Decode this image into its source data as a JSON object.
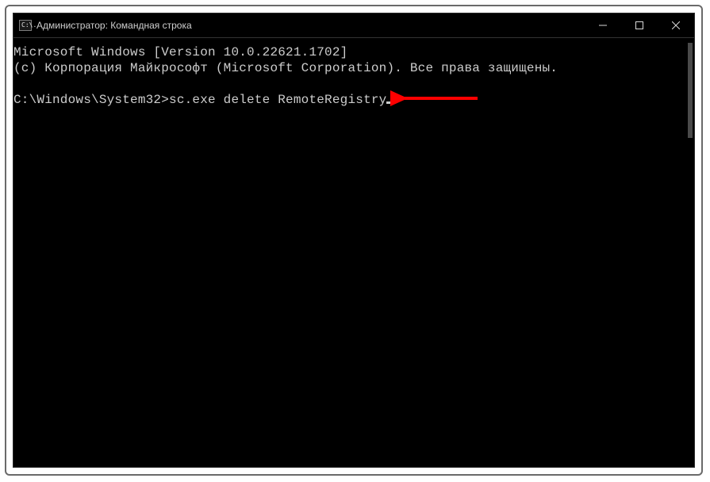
{
  "titlebar": {
    "icon_label": "C:\\.",
    "title": "Администратор: Командная строка"
  },
  "terminal": {
    "line1": "Microsoft Windows [Version 10.0.22621.1702]",
    "line2": "(c) Корпорация Майкрософт (Microsoft Corporation). Все права защищены.",
    "blank": "",
    "prompt": "C:\\Windows\\System32>",
    "command": "sc.exe delete RemoteRegistry"
  },
  "annotation": {
    "arrow_color": "#ff0000"
  }
}
